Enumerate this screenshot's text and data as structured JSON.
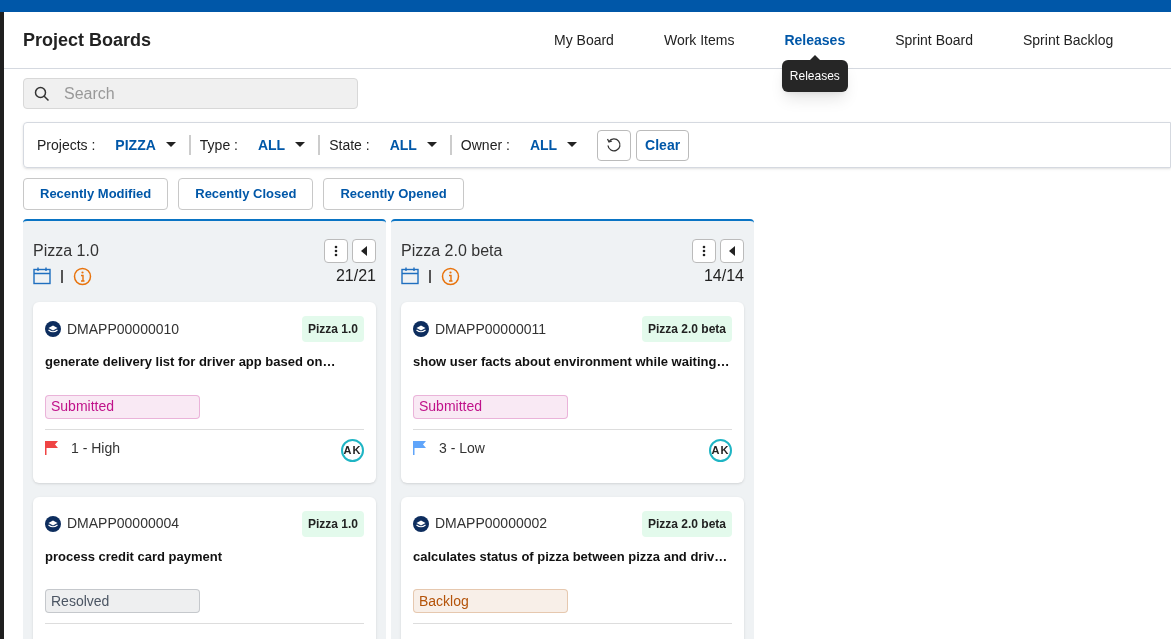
{
  "app_title": "Project Boards",
  "nav_tabs": [
    {
      "label": "My Board",
      "selected": false
    },
    {
      "label": "Work Items",
      "selected": false
    },
    {
      "label": "Releases",
      "selected": true,
      "tooltip": "Releases"
    },
    {
      "label": "Sprint Board",
      "selected": false
    },
    {
      "label": "Sprint Backlog",
      "selected": false
    }
  ],
  "search": {
    "placeholder": "Search"
  },
  "filters": [
    {
      "label": "Projects :",
      "value": "PIZZA"
    },
    {
      "label": "Type :",
      "value": "ALL"
    },
    {
      "label": "State :",
      "value": "ALL"
    },
    {
      "label": "Owner :",
      "value": "ALL"
    }
  ],
  "clear_button": "Clear",
  "quick_filters": [
    "Recently Modified",
    "Recently Closed",
    "Recently Opened"
  ],
  "columns": [
    {
      "title": "Pizza 1.0",
      "count": "21/21",
      "cards": [
        {
          "id": "DMAPP00000010",
          "release": "Pizza 1.0",
          "title": "generate delivery list for driver app based on…",
          "status": {
            "label": "Submitted",
            "color": "#c0128a"
          },
          "priority": {
            "label": "1 - High",
            "color": "#ef4444"
          },
          "owner": "AK"
        },
        {
          "id": "DMAPP00000004",
          "release": "Pizza 1.0",
          "title": "process credit card payment",
          "status": {
            "label": "Resolved",
            "color": "#4b5563"
          }
        }
      ]
    },
    {
      "title": "Pizza 2.0 beta",
      "count": "14/14",
      "cards": [
        {
          "id": "DMAPP00000011",
          "release": "Pizza 2.0 beta",
          "title": "show user facts about environment while waiting…",
          "status": {
            "label": "Submitted",
            "color": "#c0128a"
          },
          "priority": {
            "label": "3 - Low",
            "color": "#60a5fa"
          },
          "owner": "AK"
        },
        {
          "id": "DMAPP00000002",
          "release": "Pizza 2.0 beta",
          "title": "calculates status of pizza between pizza and driv…",
          "status": {
            "label": "Backlog",
            "color": "#b45309"
          }
        }
      ]
    }
  ]
}
